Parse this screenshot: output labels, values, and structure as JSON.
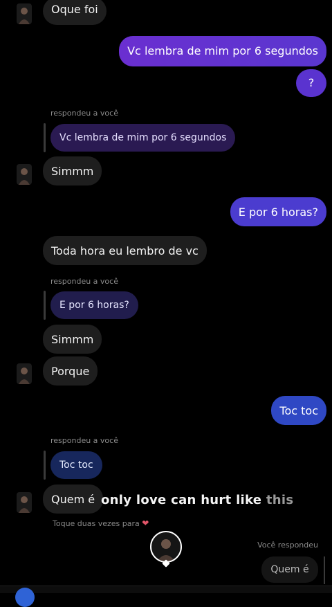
{
  "messages": {
    "m1": "Oque foi",
    "m2": "Vc lembra de mim por 6 segundos",
    "m3": "?",
    "m4_label": "respondeu a você",
    "m4_quote": "Vc lembra de mim por 6 segundos",
    "m5": "Simmm",
    "m6": "E por 6 horas?",
    "m7": "Toda hora eu  lembro de vc",
    "m8_label": "respondeu a você",
    "m8_quote": "E por 6 horas?",
    "m9": "Simmm",
    "m10": "Porque",
    "m11": "Toc toc",
    "m12_label": "respondeu a você",
    "m12_quote": "Toc toc",
    "m13": "Quem é"
  },
  "overlay": {
    "text_main": "only love can hurt like ",
    "text_fade": "this"
  },
  "footer": {
    "hint": "Toque duas vezes para",
    "hint_icon": "heart-icon",
    "you_replied": "Você respondeu",
    "reply_preview": "Quem é"
  },
  "colors": {
    "outgoing_start": "#6a2fd0",
    "outgoing_end": "#3d47c8",
    "incoming": "#1e1e1e",
    "background": "#000000"
  }
}
